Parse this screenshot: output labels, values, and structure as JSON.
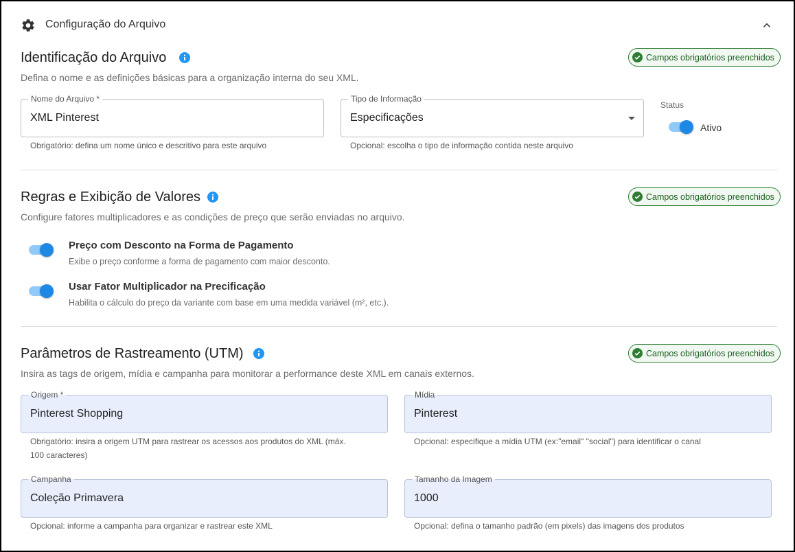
{
  "header": {
    "title": "Configuração do Arquivo",
    "gear_icon": "gear-icon",
    "collapse_icon": "chevron-up-icon"
  },
  "colors": {
    "accent": "#1e88e5",
    "success": "#2e7d32",
    "filled_field": "#e8eefc"
  },
  "identificacao": {
    "title": "Identificação do Arquivo",
    "description": "Defina o nome e as definições básicas para a organização interna do seu XML.",
    "badge": "Campos obrigatórios preenchidos",
    "nome": {
      "label": "Nome do Arquivo *",
      "value": "XML Pinterest",
      "helper": "Obrigatório: defina um nome único e descritivo para este arquivo"
    },
    "tipo": {
      "label": "Tipo de Informação",
      "value": "Especificações",
      "helper": "Opcional: escolha o tipo de informação contida neste arquivo"
    },
    "status": {
      "label": "Status",
      "value": "Ativo",
      "on": true
    }
  },
  "regras": {
    "title": "Regras e Exibição de Valores",
    "description": "Configure fatores multiplicadores e as condições de preço que serão enviadas no arquivo.",
    "badge": "Campos obrigatórios preenchidos",
    "options": [
      {
        "title": "Preço com Desconto na Forma de Pagamento",
        "description": "Exibe o preço conforme a forma de pagamento com maior desconto.",
        "on": true
      },
      {
        "title": "Usar Fator Multiplicador na Precificação",
        "description": "Habilita o cálculo do preço da variante com base em uma medida variável (m², etc.).",
        "on": true
      }
    ]
  },
  "utm": {
    "title": "Parâmetros de Rastreamento (UTM)",
    "description": "Insira as tags de origem, mídia e campanha para monitorar a performance deste XML em canais externos.",
    "badge": "Campos obrigatórios preenchidos",
    "origem": {
      "label": "Origem *",
      "value": "Pinterest Shopping",
      "helper_line1": "Obrigatório: insira a origem UTM para rastrear os acessos aos produtos do XML (máx.",
      "helper_line2": "100 caracteres)"
    },
    "midia": {
      "label": "Mídia",
      "value": "Pinterest",
      "helper": "Opcional: especifique a mídia UTM (ex:\"email\" \"social\") para identificar o canal"
    },
    "campanha": {
      "label": "Campanha",
      "value": "Coleção Primavera",
      "helper": "Opcional: informe a campanha para organizar e rastrear este XML"
    },
    "tamanho": {
      "label": "Tamanho da Imagem",
      "value": "1000",
      "helper": "Opcional: defina o tamanho padrão (em pixels) das imagens dos produtos"
    }
  }
}
